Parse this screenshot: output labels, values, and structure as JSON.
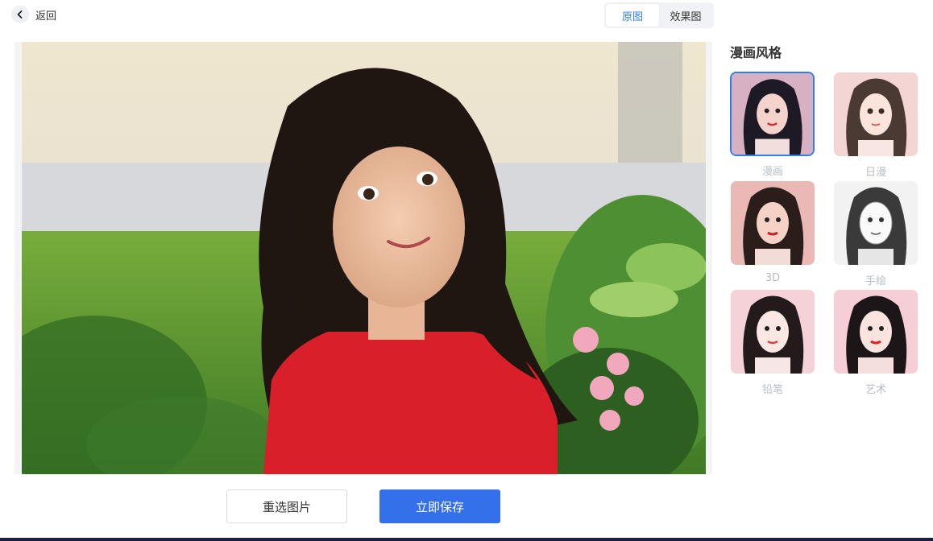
{
  "header": {
    "back_label": "返回",
    "toggle": {
      "original_label": "原图",
      "effect_label": "效果图",
      "active": "original"
    }
  },
  "actions": {
    "reselect_label": "重选图片",
    "save_label": "立即保存"
  },
  "style_panel": {
    "title": "漫画风格",
    "selected": "漫画",
    "items": [
      {
        "label": "漫画",
        "bg": "#d8b0c4"
      },
      {
        "label": "日漫",
        "bg": "#f3d6d4"
      },
      {
        "label": "3D",
        "bg": "#eab9b5"
      },
      {
        "label": "手绘",
        "bg": "#f2f2f2"
      },
      {
        "label": "铅笔",
        "bg": "#f4d2d8"
      },
      {
        "label": "艺术",
        "bg": "#f6cfd6"
      }
    ]
  },
  "colors": {
    "accent": "#2f7ee8",
    "primary_button": "#3370ea"
  }
}
